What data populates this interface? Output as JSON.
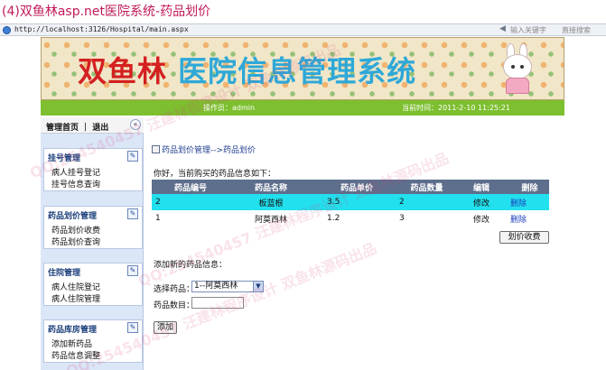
{
  "caption": "(4)双鱼林asp.net医院系统-药品划价",
  "browser": {
    "url": "http://localhost:3126/Hospital/main.aspx",
    "search_placeholder": "输入关键字",
    "search_go": "直接搜索"
  },
  "banner": {
    "title_part1": "双鱼林",
    "title_part2": "医院信息管理系统"
  },
  "infobar": {
    "operator_label": "操作员：",
    "operator": "admin",
    "time_label": "当前时间：",
    "time": "2011-2-10 11:25:21"
  },
  "sidebar": {
    "header": "管理首页 ｜ 退出",
    "groups": [
      {
        "title": "挂号管理",
        "items": [
          "病人挂号登记",
          "挂号信息查询"
        ]
      },
      {
        "title": "药品划价管理",
        "items": [
          "药品划价收费",
          "药品划价查询"
        ]
      },
      {
        "title": "住院管理",
        "items": [
          "病人住院登记",
          "病人住院管理"
        ]
      },
      {
        "title": "药品库房管理",
        "items": [
          "添加新药品",
          "药品信息调整"
        ]
      }
    ]
  },
  "main": {
    "breadcrumb": "药品划价管理-->药品划价",
    "greeting": "你好，当前购买的药品信息如下：",
    "table": {
      "headers": [
        "药品编号",
        "药品名称",
        "药品单价",
        "药品数量",
        "编辑",
        "删除"
      ],
      "rows": [
        [
          "2",
          "板蓝根",
          "3.5",
          "2",
          "修改",
          "删除"
        ],
        [
          "1",
          "阿莫西林",
          "1.2",
          "3",
          "修改",
          "删除"
        ]
      ]
    },
    "bill_button": "划价收费",
    "add_title": "添加新的药品信息：",
    "select_label": "选择药品：",
    "select_value": "1--阿莫西林",
    "qty_label": "药品数目：",
    "qty_value": "",
    "add_button": "添加"
  },
  "watermark": "QQ:254540457 汪建林程序设计 双鱼林源码出品"
}
